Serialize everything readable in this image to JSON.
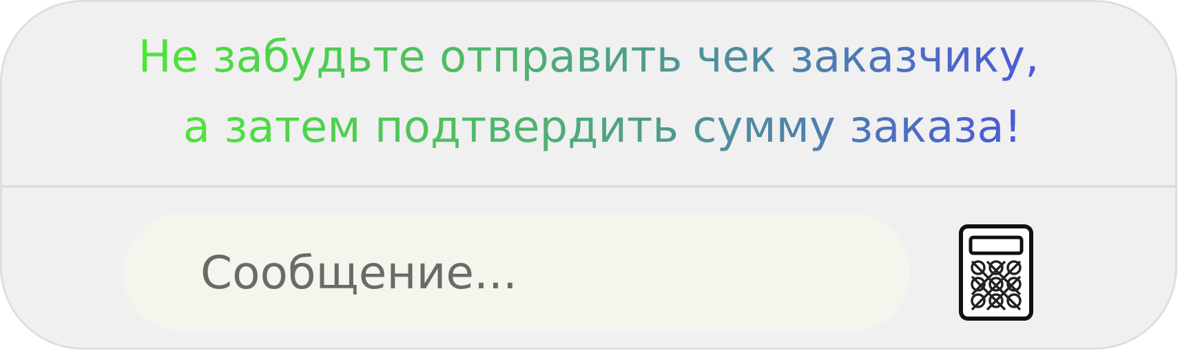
{
  "reminder": {
    "line_1": "Не забудьте отправить чек заказчику,",
    "line_2": "а затем подтвердить сумму заказа!"
  },
  "composer": {
    "placeholder": "Сообщение...",
    "value": ""
  },
  "icons": {
    "calculator": "calculator-icon"
  },
  "colors": {
    "gradient_start": "#4ee637",
    "gradient_mid": "#4f8ca0",
    "gradient_end": "#4b59d8",
    "panel_background": "#f0f0f0",
    "input_background": "#f4f6ed",
    "placeholder_text": "#686b67",
    "divider": "#dddddd"
  }
}
